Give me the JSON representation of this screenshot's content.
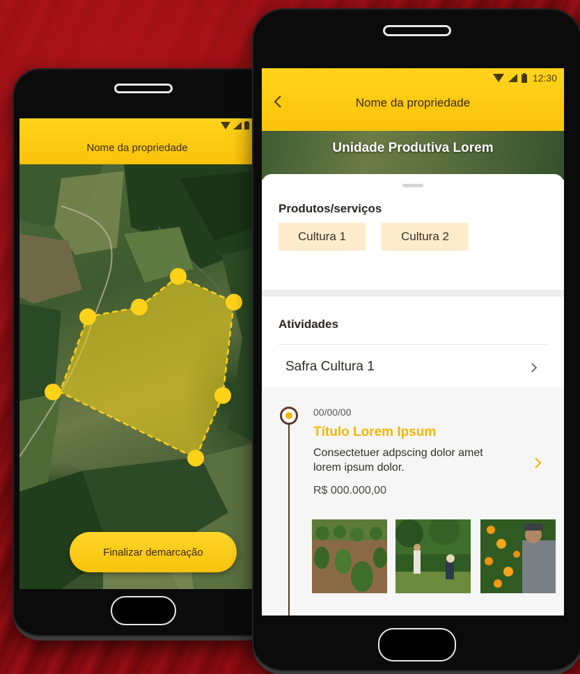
{
  "colors": {
    "accent": "#f8c20c",
    "accent_text": "#f2b705",
    "chip_bg": "#fdeccb",
    "polygon_fill": "#e6c81e",
    "vertex": "#ffd21a"
  },
  "left_phone": {
    "app_bar": {
      "title": "Nome da propriedade"
    },
    "finalize_button": {
      "label": "Finalizar demarcação"
    }
  },
  "right_phone": {
    "status": {
      "time": "12:30"
    },
    "app_bar": {
      "title": "Nome da propriedade",
      "back_icon": "chevron-left-icon"
    },
    "hero": {
      "title": "Unidade Produtiva Lorem"
    },
    "products": {
      "label": "Produtos/serviços",
      "chips": [
        "Cultura 1",
        "Cultura 2"
      ]
    },
    "activities": {
      "label": "Atividades",
      "items": [
        {
          "label": "Safra Cultura 1"
        }
      ]
    },
    "timeline": {
      "date": "00/00/00",
      "title": "Título Lorem Ipsum",
      "description": "Consectetuer adpscing dolor amet lorem ipsum dolor.",
      "price": "R$ 000.000,00"
    }
  }
}
